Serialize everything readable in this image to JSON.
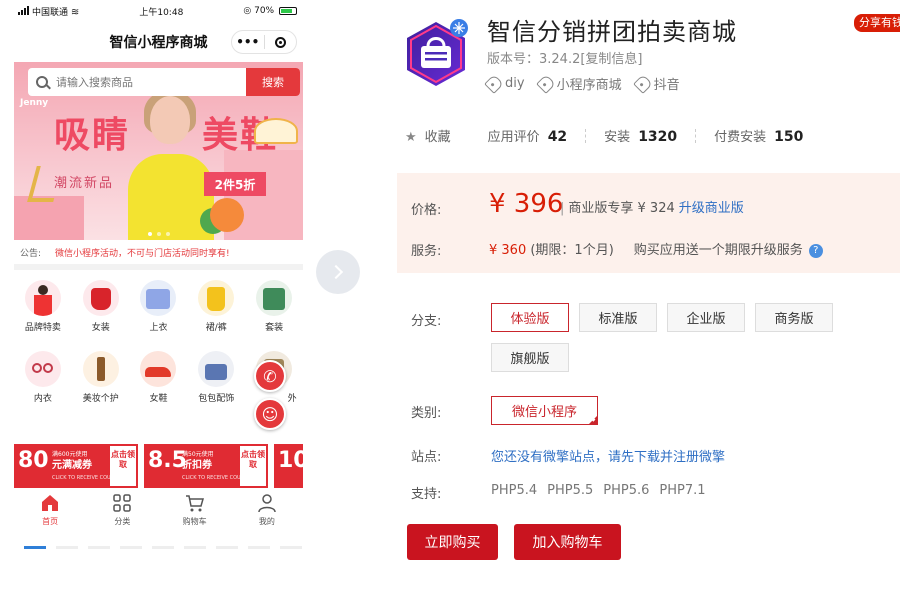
{
  "phone": {
    "status": {
      "carrier": "中国联通",
      "time": "上午10:48",
      "battery": "70%"
    },
    "title": "智信小程序商城",
    "capsule": {
      "more": "•••"
    },
    "search": {
      "placeholder": "请输入搜索商品",
      "button": "搜索"
    },
    "banner": {
      "logo": "Jenny",
      "big_left": "吸睛",
      "big_right": "美鞋",
      "subtitle": "潮流新品",
      "tag": "2件5折"
    },
    "notice": {
      "label": "公告:",
      "text": "微信小程序活动，不可与门店活动同时享有!"
    },
    "categories": [
      {
        "name": "品牌特卖",
        "icon": "brand-sale-icon"
      },
      {
        "name": "女装",
        "icon": "women-clothing-icon"
      },
      {
        "name": "上衣",
        "icon": "top-icon"
      },
      {
        "name": "裙/裤",
        "icon": "skirt-pants-icon"
      },
      {
        "name": "套装",
        "icon": "suit-icon"
      },
      {
        "name": "内衣",
        "icon": "underwear-icon"
      },
      {
        "name": "美妆个护",
        "icon": "cosmetics-icon"
      },
      {
        "name": "女鞋",
        "icon": "women-shoes-icon"
      },
      {
        "name": "包包配饰",
        "icon": "bag-accessory-icon"
      },
      {
        "name": "外",
        "icon": "outerwear-icon"
      }
    ],
    "coupons": [
      {
        "amount": "80",
        "line1": "满600元使用",
        "line2": "元满减券",
        "line3": "CLICK TO RECEIVE COUPONS",
        "get": "点击领取"
      },
      {
        "amount": "8.5",
        "line1": "满50元使用",
        "line2": "折扣券",
        "line3": "CLICK TO RECEIVE COUPONS",
        "get": "点击领取"
      },
      {
        "amount": "10",
        "line1": "",
        "line2": "",
        "line3": "",
        "get": ""
      }
    ],
    "tabbar": [
      {
        "label": "首页",
        "icon": "home-icon",
        "active": true
      },
      {
        "label": "分类",
        "icon": "category-grid-icon",
        "active": false
      },
      {
        "label": "购物车",
        "icon": "cart-icon",
        "active": false
      },
      {
        "label": "我的",
        "icon": "user-icon",
        "active": false
      }
    ]
  },
  "product": {
    "title": "智信分销拼团拍卖商城",
    "share_badge": "分享有钱",
    "version": "版本号：3.24.2[复制信息]",
    "tags": [
      "diy",
      "小程序商城",
      "抖音"
    ],
    "stats": {
      "favorite": "收藏",
      "rating_label": "应用评价",
      "rating_value": "42",
      "install_label": "安装",
      "install_value": "1320",
      "paid_label": "付费安装",
      "paid_value": "150"
    },
    "price": {
      "label": "价格:",
      "value": "¥ 396",
      "biz_text": "商业版专享 ¥ 324",
      "upgrade": "升级商业版",
      "service_label": "服务:",
      "service_price": "¥ 360",
      "service_period": "(期限：1个月)",
      "gift": "购买应用送一个期限升级服务",
      "help_icon": "?"
    },
    "edition_label": "分支:",
    "editions": [
      "体验版",
      "标准版",
      "企业版",
      "商务版",
      "旗舰版"
    ],
    "selected_edition": "体验版",
    "category_label": "类别:",
    "category_value": "微信小程序",
    "site_label": "站点:",
    "site_text": "您还没有微擎站点，请先下载并注册微擎",
    "support_label": "支持:",
    "php_versions": [
      "PHP5.4",
      "PHP5.5",
      "PHP5.6",
      "PHP7.1"
    ],
    "buy_now": "立即购买",
    "add_cart": "加入购物车"
  },
  "colors": {
    "accent_red": "#d81e06",
    "link_blue": "#2f6fc4",
    "price_bg": "#fdf1ec"
  }
}
